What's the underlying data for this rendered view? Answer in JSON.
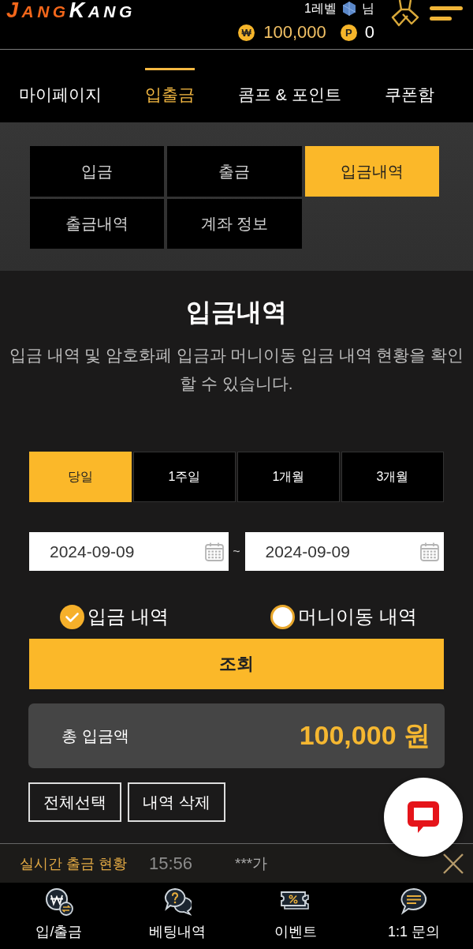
{
  "header": {
    "logo": [
      "JANG",
      "KANG"
    ],
    "level": "1레벨",
    "honorific": "님",
    "balance": {
      "symbol": "₩",
      "amount": "100,000"
    },
    "points": {
      "symbol": "P",
      "amount": "0"
    }
  },
  "nav_tabs": [
    {
      "label": "마이페이지",
      "selected": false
    },
    {
      "label": "입출금",
      "selected": true
    },
    {
      "label": "콤프 & 포인트",
      "selected": false
    },
    {
      "label": "쿠폰함",
      "selected": false
    }
  ],
  "sub_tabs": [
    {
      "label": "입금",
      "selected": false
    },
    {
      "label": "출금",
      "selected": false
    },
    {
      "label": "입금내역",
      "selected": true
    },
    {
      "label": "출금내역",
      "selected": false
    },
    {
      "label": "계좌 정보",
      "selected": false
    }
  ],
  "page": {
    "title": "입금내역",
    "description": "입금 내역 및 암호화폐 입금과 머니이동 입금 내역 현황을 확인 할 수 있습니다."
  },
  "periods": [
    {
      "label": "당일",
      "selected": true
    },
    {
      "label": "1주일",
      "selected": false
    },
    {
      "label": "1개월",
      "selected": false
    },
    {
      "label": "3개월",
      "selected": false
    }
  ],
  "date_range": {
    "start": "2024-09-09",
    "separator": "~",
    "end": "2024-09-09"
  },
  "filters": [
    {
      "label": "입금 내역",
      "selected": true
    },
    {
      "label": "머니이동 내역",
      "selected": false
    }
  ],
  "search_button": "조회",
  "total": {
    "label": "총 입금액",
    "amount": "100,000 원"
  },
  "actions": [
    "전체선택",
    "내역 삭제"
  ],
  "ticker": {
    "title": "실시간 출금 현황",
    "time": "15:56",
    "message": "***가"
  },
  "bottom_nav": [
    {
      "kind": "exchange",
      "label": "입/출금"
    },
    {
      "kind": "betting",
      "label": "베팅내역"
    },
    {
      "kind": "event",
      "label": "이벤트"
    },
    {
      "kind": "inquiry",
      "label": "1:1 문의"
    }
  ]
}
